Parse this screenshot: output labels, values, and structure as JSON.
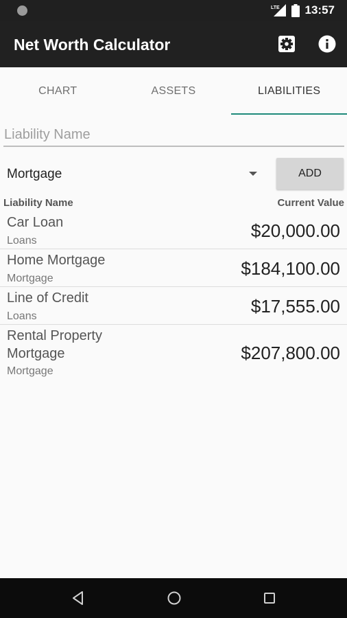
{
  "status_bar": {
    "time": "13:57",
    "network": "LTE"
  },
  "app_bar": {
    "title": "Net Worth Calculator",
    "icons": [
      "settings-icon",
      "info-icon"
    ]
  },
  "tabs": [
    {
      "label": "CHART",
      "active": false
    },
    {
      "label": "ASSETS",
      "active": false
    },
    {
      "label": "LIABILITIES",
      "active": true
    }
  ],
  "form": {
    "name_placeholder": "Liability Name",
    "name_value": "",
    "type_selected": "Mortgage",
    "add_label": "ADD"
  },
  "table": {
    "headers": {
      "name": "Liability Name",
      "value": "Current Value"
    },
    "rows": [
      {
        "name": "Car Loan",
        "category": "Loans",
        "value": "$20,000.00"
      },
      {
        "name": "Home Mortgage",
        "category": "Mortgage",
        "value": "$184,100.00"
      },
      {
        "name": "Line of Credit",
        "category": "Loans",
        "value": "$17,555.00"
      },
      {
        "name": "Rental Property Mortgage",
        "category": "Mortgage",
        "value": "$207,800.00"
      }
    ]
  },
  "colors": {
    "app_bar": "#212121",
    "accent": "#1e8a7a",
    "button": "#d6d6d6"
  }
}
